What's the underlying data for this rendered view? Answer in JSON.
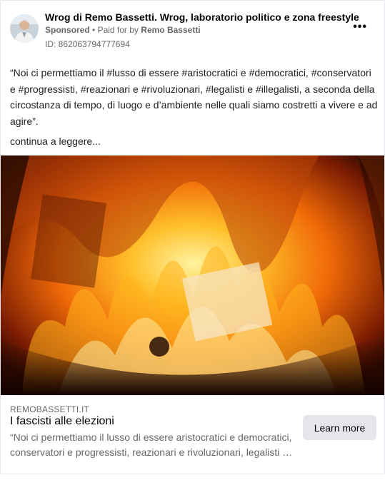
{
  "ad": {
    "page_name": "Wrog di Remo Bassetti. Wrog, laboratorio politico e zona freestyle",
    "sponsored_label": "Sponsored",
    "separator": "•",
    "paid_for_prefix": "Paid for by",
    "paid_for_name": "Remo Bassetti",
    "ad_id": "ID: 862063794777694",
    "more_icon": "more-horizontal-icon",
    "more_glyph": "•••"
  },
  "post": {
    "body": "“Noi ci permettiamo il #lusso di essere #aristocratici e #democratici, #conservatori e #progressisti, #reazionari e #rivoluzionari, #legalisti e #illegalisti, a seconda della circostanza di tempo, di luogo e d’ambiente nelle quali siamo costretti a vivere e ad agire”.",
    "read_more": "continua a leggere..."
  },
  "link": {
    "domain": "REMOBASSETTI.IT",
    "title": "I fascisti alle elezioni",
    "description_line1": "“Noi ci permettiamo il lusso di essere aristocratici e democratici,",
    "description_line2": "conservatori e progressisti, reazionari e rivoluzionari, legalisti e…",
    "cta_label": "Learn more"
  },
  "colors": {
    "text_primary": "#050505",
    "text_secondary": "#65676b",
    "button_bg": "#e4e6eb",
    "fire_orange": "#f07b10",
    "fire_yellow": "#ffd24a"
  }
}
